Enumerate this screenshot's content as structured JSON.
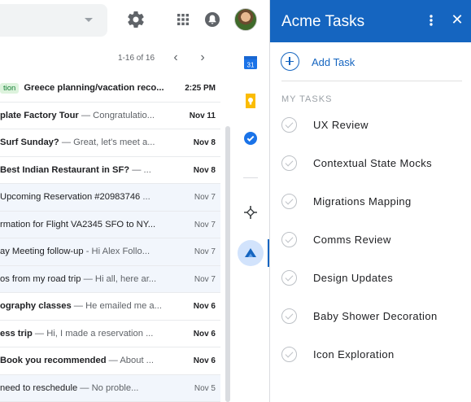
{
  "gmail": {
    "pager_range": "1-16 of 16",
    "emails": [
      {
        "label": "tion",
        "text": "Greece planning/vacation reco...",
        "snippet": "",
        "date": "2:25 PM",
        "unread": true
      },
      {
        "label": "",
        "text": "plate Factory Tour",
        "snippet": " — Congratulatio...",
        "date": "Nov 11",
        "unread": true
      },
      {
        "label": "",
        "text": "Surf Sunday?",
        "snippet": " — Great, let's meet a...",
        "date": "Nov 8",
        "unread": true
      },
      {
        "label": "",
        "text": "Best Indian Restaurant in SF?",
        "snippet": " — ...",
        "date": "Nov 8",
        "unread": true
      },
      {
        "label": "",
        "text": "Upcoming Reservation #20983746",
        "snippet": " ...",
        "date": "Nov 7",
        "unread": false
      },
      {
        "label": "",
        "text": "rmation for Flight VA2345 SFO to NY...",
        "snippet": "",
        "date": "Nov 7",
        "unread": false
      },
      {
        "label": "",
        "text": "ay Meeting follow-up",
        "snippet": " - Hi Alex Follo...",
        "date": "Nov 7",
        "unread": false
      },
      {
        "label": "",
        "text": "os from my road trip",
        "snippet": " — Hi all, here ar...",
        "date": "Nov 7",
        "unread": false
      },
      {
        "label": "",
        "text": "ography classes",
        "snippet": " — He emailed me a...",
        "date": "Nov 6",
        "unread": true
      },
      {
        "label": "",
        "text": "ess trip",
        "snippet": " — Hi, I made a reservation ...",
        "date": "Nov 6",
        "unread": true
      },
      {
        "label": "",
        "text": "Book you recommended",
        "snippet": " — About ...",
        "date": "Nov 6",
        "unread": true
      },
      {
        "label": "",
        "text": "need to reschedule",
        "snippet": " — No proble...",
        "date": "Nov 5",
        "unread": false
      }
    ]
  },
  "panel": {
    "title": "Acme Tasks",
    "add_task_label": "Add Task",
    "section_label": "MY TASKS",
    "tasks": [
      "UX Review",
      "Contextual State Mocks",
      "Migrations Mapping",
      "Comms Review",
      "Design Updates",
      "Baby Shower Decoration",
      "Icon Exploration"
    ],
    "header_color": "#1565c0"
  },
  "icons": {
    "toolbar": [
      "settings-icon",
      "apps-grid-icon",
      "notifications-icon",
      "user-avatar"
    ],
    "rail": [
      "calendar-icon",
      "keep-icon",
      "tasks-icon",
      "add-addon-icon",
      "acme-addon-icon"
    ]
  }
}
